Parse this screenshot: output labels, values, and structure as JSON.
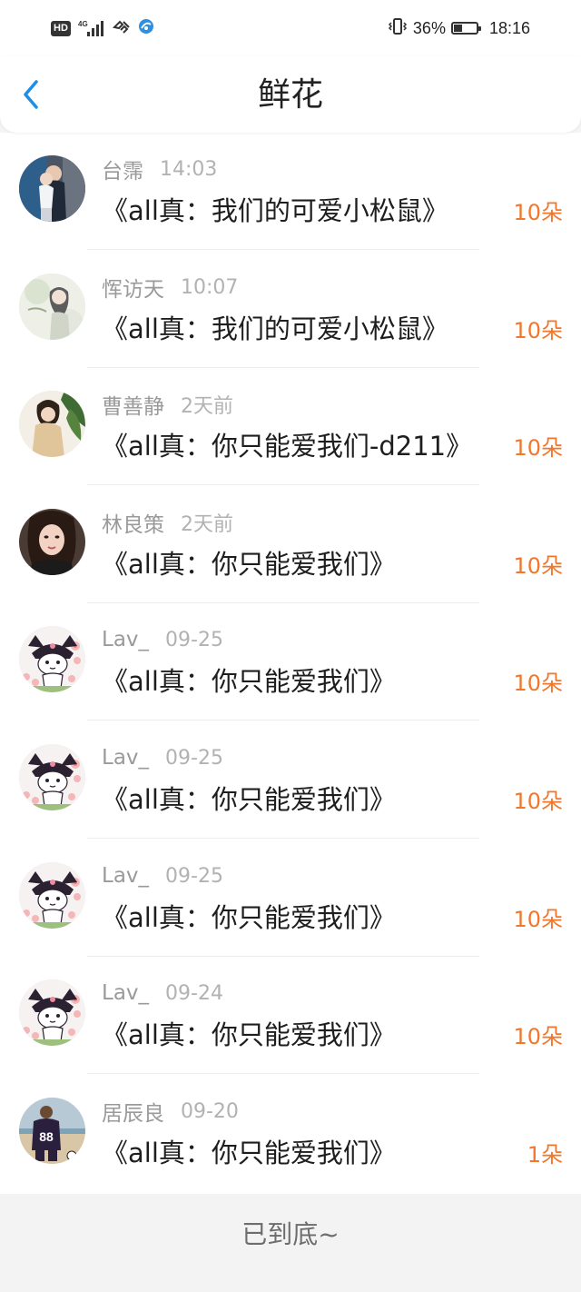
{
  "status_bar": {
    "hd": "HD",
    "network": "4G",
    "battery": "36%",
    "battery_level": 0.36,
    "time": "18:16"
  },
  "header": {
    "title": "鲜花"
  },
  "rows": [
    {
      "name": "台霈",
      "time": "14:03",
      "title": "《all真：我们的可爱小松鼠》",
      "count": "10朵",
      "avatar": "photo-couple"
    },
    {
      "name": "恽访天",
      "time": "10:07",
      "title": "《all真：我们的可爱小松鼠》",
      "count": "10朵",
      "avatar": "photo-girl-light"
    },
    {
      "name": "曹善静",
      "time": "2天前",
      "title": "《all真：你只能爱我们-d211》",
      "count": "10朵",
      "avatar": "photo-girl-leaf"
    },
    {
      "name": "林良策",
      "time": "2天前",
      "title": "《all真：你只能爱我们》",
      "count": "10朵",
      "avatar": "photo-girl-dark"
    },
    {
      "name": "Lav_",
      "time": "09-25",
      "title": "《all真：你只能爱我们》",
      "count": "10朵",
      "avatar": "kuromi-cartoon"
    },
    {
      "name": "Lav_",
      "time": "09-25",
      "title": "《all真：你只能爱我们》",
      "count": "10朵",
      "avatar": "kuromi-cartoon"
    },
    {
      "name": "Lav_",
      "time": "09-25",
      "title": "《all真：你只能爱我们》",
      "count": "10朵",
      "avatar": "kuromi-cartoon"
    },
    {
      "name": "Lav_",
      "time": "09-24",
      "title": "《all真：你只能爱我们》",
      "count": "10朵",
      "avatar": "kuromi-cartoon"
    },
    {
      "name": "居辰良",
      "time": "09-20",
      "title": "《all真：你只能爱我们》",
      "count": "1朵",
      "avatar": "photo-football-88"
    }
  ],
  "footer": {
    "text": "已到底~"
  },
  "colors": {
    "accent": "#f0772c",
    "back_icon": "#1e8fe6"
  }
}
